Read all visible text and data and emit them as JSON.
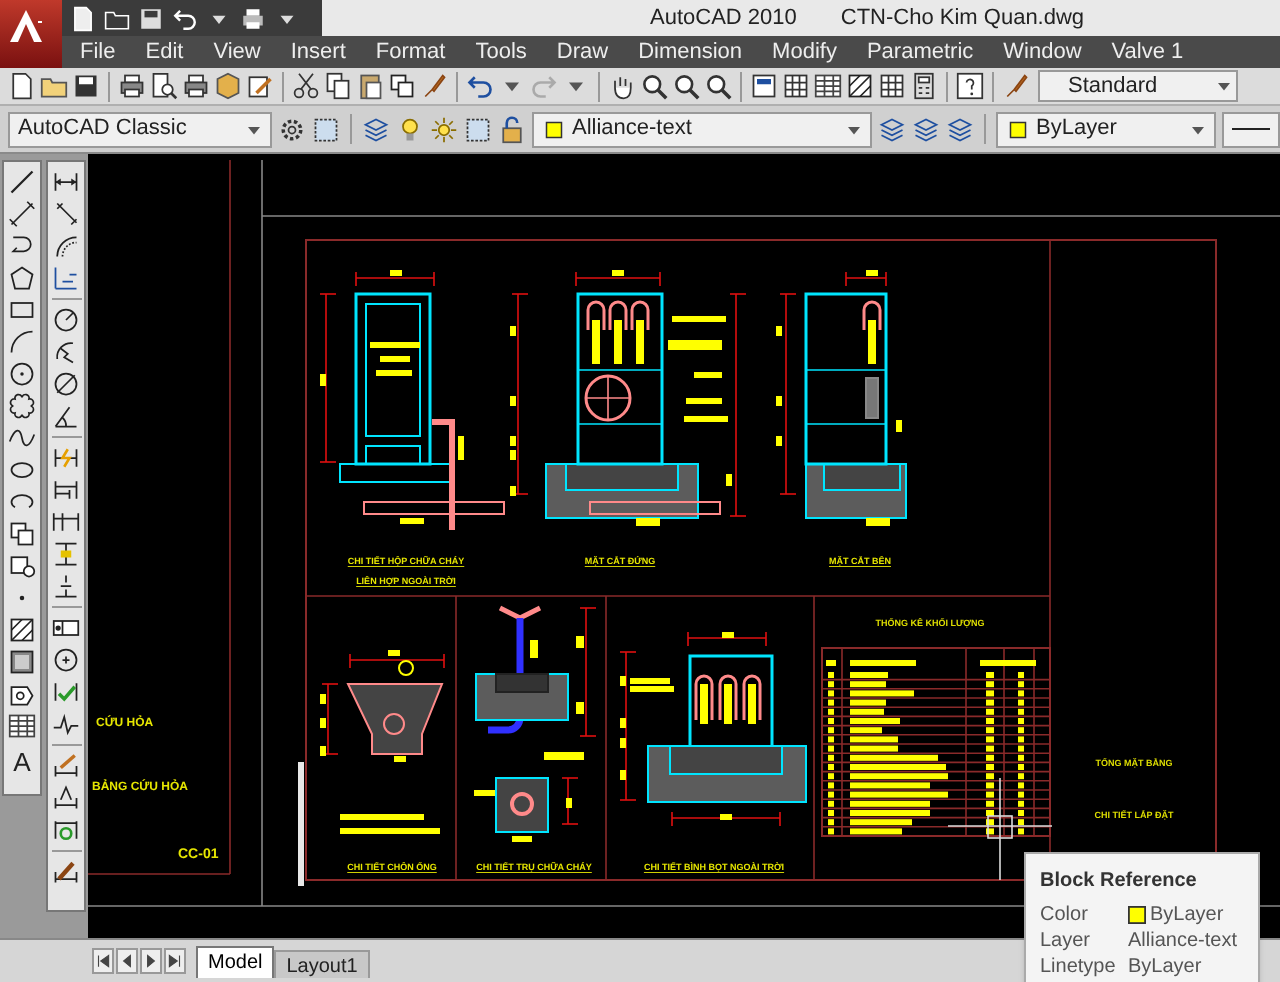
{
  "window": {
    "app_title": "AutoCAD 2010",
    "document_title": "CTN-Cho Kim Quan.dwg"
  },
  "menu": [
    "File",
    "Edit",
    "View",
    "Insert",
    "Format",
    "Tools",
    "Draw",
    "Dimension",
    "Modify",
    "Parametric",
    "Window",
    "Valve 1"
  ],
  "toolbar": {
    "text_style": "Standard"
  },
  "workspace": {
    "value": "AutoCAD Classic"
  },
  "layer": {
    "value": "Alliance-text"
  },
  "color_control": {
    "value": "ByLayer"
  },
  "draw_toolbar": {
    "text_glyph": "A"
  },
  "drawing": {
    "labels": [
      "CỨU HỎA",
      "BẢNG CỨU HỎA",
      "CC-01",
      "CHI TIẾT HỘP CHỮA CHÁY",
      "LIÊN HỢP NGOÀI TRỜI",
      "MẶT CẮT ĐỨNG",
      "MẶT CẮT BÊN",
      "THỐNG KÊ KHỐI LƯỢNG",
      "CHI TIẾT CHÔN ỐNG",
      "CHI TIẾT TRỤ CHỮA CHÁY",
      "CHI TIẾT BÌNH BỌT NGOÀI TRỜI",
      "TỔNG MẶT BẰNG",
      "CHI TIẾT LẮP ĐẶT"
    ]
  },
  "layout_tabs": [
    {
      "label": "Model",
      "selected": true
    },
    {
      "label": "Layout1",
      "selected": false
    }
  ],
  "tooltip": {
    "title": "Block Reference",
    "rows": [
      {
        "label": "Color",
        "value": "ByLayer",
        "kind": "swatch"
      },
      {
        "label": "Layer",
        "value": "Alliance-text",
        "kind": "text"
      },
      {
        "label": "Linetype",
        "value": "ByLayer",
        "kind": "text"
      }
    ]
  }
}
